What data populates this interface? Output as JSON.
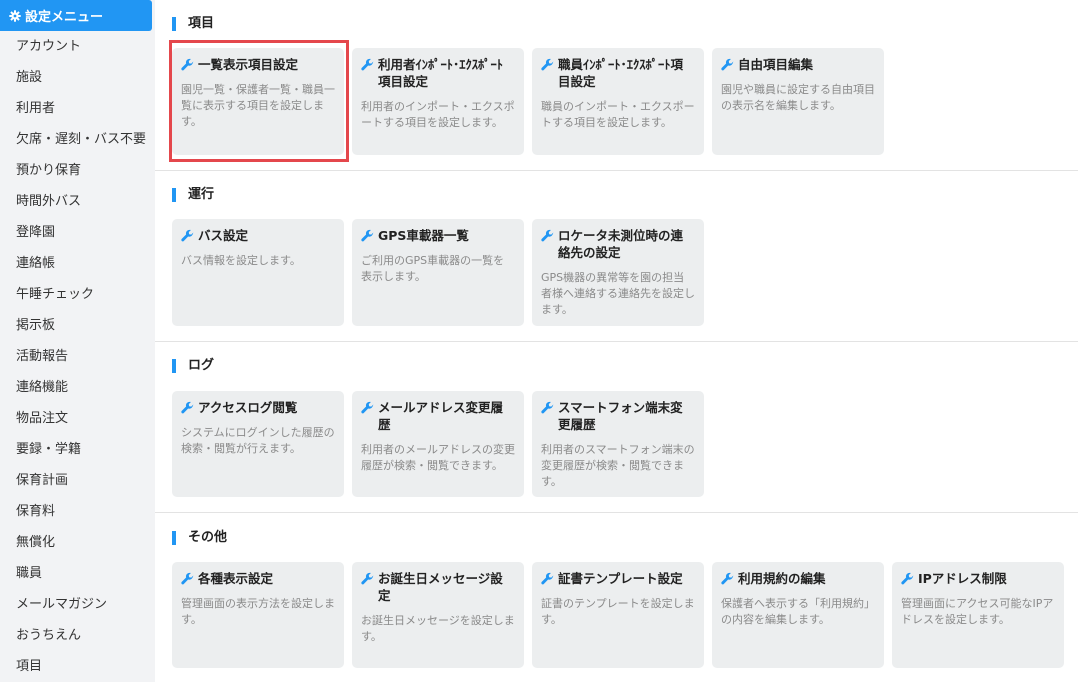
{
  "sidebar": {
    "header": "設定メニュー",
    "items": [
      "アカウント",
      "施設",
      "利用者",
      "欠席・遅刻・バス不要",
      "預かり保育",
      "時間外バス",
      "登降園",
      "連絡帳",
      "午睡チェック",
      "掲示板",
      "活動報告",
      "連絡機能",
      "物品注文",
      "要録・学籍",
      "保育計画",
      "保育料",
      "無償化",
      "職員",
      "メールマガジン",
      "おうちえん",
      "項目"
    ]
  },
  "sections": [
    {
      "title": "項目",
      "cards": [
        {
          "title": "一覧表示項目設定",
          "desc": "園児一覧・保護者一覧・職員一覧に表示する項目を設定します。"
        },
        {
          "title": "利用者ｲﾝﾎﾟｰﾄ･ｴｸｽﾎﾟｰﾄ項目設定",
          "desc": "利用者のインポート・エクスポートする項目を設定します。"
        },
        {
          "title": "職員ｲﾝﾎﾟｰﾄ･ｴｸｽﾎﾟｰﾄ項目設定",
          "desc": "職員のインポート・エクスポートする項目を設定します。"
        },
        {
          "title": "自由項目編集",
          "desc": "園児や職員に設定する自由項目の表示名を編集します。"
        }
      ]
    },
    {
      "title": "運行",
      "cards": [
        {
          "title": "バス設定",
          "desc": "バス情報を設定します。"
        },
        {
          "title": "GPS車載器一覧",
          "desc": "ご利用のGPS車載器の一覧を表示します。"
        },
        {
          "title": "ロケータ未測位時の連絡先の設定",
          "desc": "GPS機器の異常等を園の担当者様へ連絡する連絡先を設定します。"
        }
      ]
    },
    {
      "title": "ログ",
      "cards": [
        {
          "title": "アクセスログ閲覧",
          "desc": "システムにログインした履歴の検索・閲覧が行えます。"
        },
        {
          "title": "メールアドレス変更履歴",
          "desc": "利用者のメールアドレスの変更履歴が検索・閲覧できます。"
        },
        {
          "title": "スマートフォン端末変更履歴",
          "desc": "利用者のスマートフォン端末の変更履歴が検索・閲覧できます。"
        }
      ]
    },
    {
      "title": "その他",
      "cards": [
        {
          "title": "各種表示設定",
          "desc": "管理画面の表示方法を設定します。"
        },
        {
          "title": "お誕生日メッセージ設定",
          "desc": "お誕生日メッセージを設定します。"
        },
        {
          "title": "証書テンプレート設定",
          "desc": "証書のテンプレートを設定します。"
        },
        {
          "title": "利用規約の編集",
          "desc": "保護者へ表示する「利用規約」の内容を編集します。"
        },
        {
          "title": "IPアドレス制限",
          "desc": "管理画面にアクセス可能なIPアドレスを設定します。"
        }
      ]
    }
  ],
  "colors": {
    "accent": "#2196f3",
    "card_bg": "#eceeef",
    "sidebar_bg": "#f2f3f5",
    "highlight": "#e4474c"
  },
  "icons": {
    "header": "gear-icon",
    "card": "wrench-icon"
  }
}
